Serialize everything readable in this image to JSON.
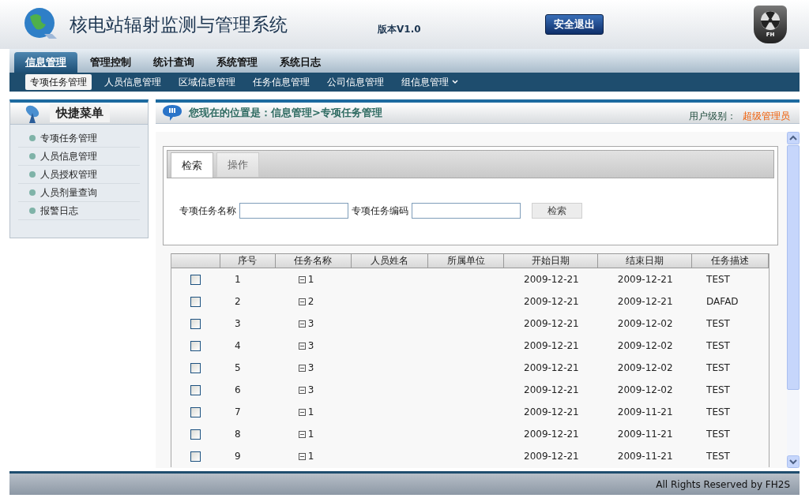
{
  "header": {
    "title": "核电站辐射监测与管理系统",
    "version": "版本V1.0",
    "logout": "安全退出",
    "badge": "FH"
  },
  "main_nav": [
    {
      "label": "信息管理",
      "selected": true
    },
    {
      "label": "管理控制",
      "selected": false
    },
    {
      "label": "统计查询",
      "selected": false
    },
    {
      "label": "系统管理",
      "selected": false
    },
    {
      "label": "系统日志",
      "selected": false
    }
  ],
  "sub_nav": [
    {
      "label": "专项任务管理",
      "selected": true,
      "dropdown": false
    },
    {
      "label": "人员信息管理",
      "selected": false,
      "dropdown": false
    },
    {
      "label": "区域信息管理",
      "selected": false,
      "dropdown": false
    },
    {
      "label": "任务信息管理",
      "selected": false,
      "dropdown": false
    },
    {
      "label": "公司信息管理",
      "selected": false,
      "dropdown": false
    },
    {
      "label": "组信息管理",
      "selected": false,
      "dropdown": true
    }
  ],
  "sidebar": {
    "title": "快捷菜单",
    "items": [
      "专项任务管理",
      "人员信息管理",
      "人员授权管理",
      "人员剂量查询",
      "报警日志"
    ]
  },
  "breadcrumb": "您现在的位置是：信息管理>专项任务管理",
  "user_level": {
    "label": "用户级别：",
    "value": "超级管理员"
  },
  "tabs": [
    {
      "label": "检索",
      "selected": true
    },
    {
      "label": "操作",
      "selected": false
    }
  ],
  "search": {
    "fields": [
      {
        "label": "专项任务名称"
      },
      {
        "label": "专项任务编码"
      }
    ],
    "button": "检索"
  },
  "table": {
    "columns": [
      "序号",
      "任务名称",
      "人员姓名",
      "所属单位",
      "开始日期",
      "结束日期",
      "任务描述"
    ],
    "rows": [
      {
        "checked": false,
        "cells": [
          "1",
          "1",
          "",
          "",
          "2009-12-21",
          "2009-12-21",
          "TEST"
        ]
      },
      {
        "checked": false,
        "cells": [
          "2",
          "2",
          "",
          "",
          "2009-12-21",
          "2009-12-21",
          "DAFAD"
        ]
      },
      {
        "checked": false,
        "cells": [
          "3",
          "3",
          "",
          "",
          "2009-12-21",
          "2009-12-02",
          "TEST"
        ]
      },
      {
        "checked": false,
        "cells": [
          "4",
          "3",
          "",
          "",
          "2009-12-21",
          "2009-12-02",
          "TEST"
        ]
      },
      {
        "checked": false,
        "cells": [
          "5",
          "3",
          "",
          "",
          "2009-12-21",
          "2009-12-02",
          "TEST"
        ]
      },
      {
        "checked": false,
        "cells": [
          "6",
          "3",
          "",
          "",
          "2009-12-21",
          "2009-12-02",
          "TEST"
        ]
      },
      {
        "checked": false,
        "cells": [
          "7",
          "1",
          "",
          "",
          "2009-12-21",
          "2009-11-21",
          "TEST"
        ]
      },
      {
        "checked": false,
        "cells": [
          "8",
          "1",
          "",
          "",
          "2009-12-21",
          "2009-11-21",
          "TEST"
        ]
      },
      {
        "checked": false,
        "cells": [
          "9",
          "1",
          "",
          "",
          "2009-12-21",
          "2009-11-21",
          "TEST"
        ]
      }
    ]
  },
  "footer": "All Rights Reserved by FH2S"
}
